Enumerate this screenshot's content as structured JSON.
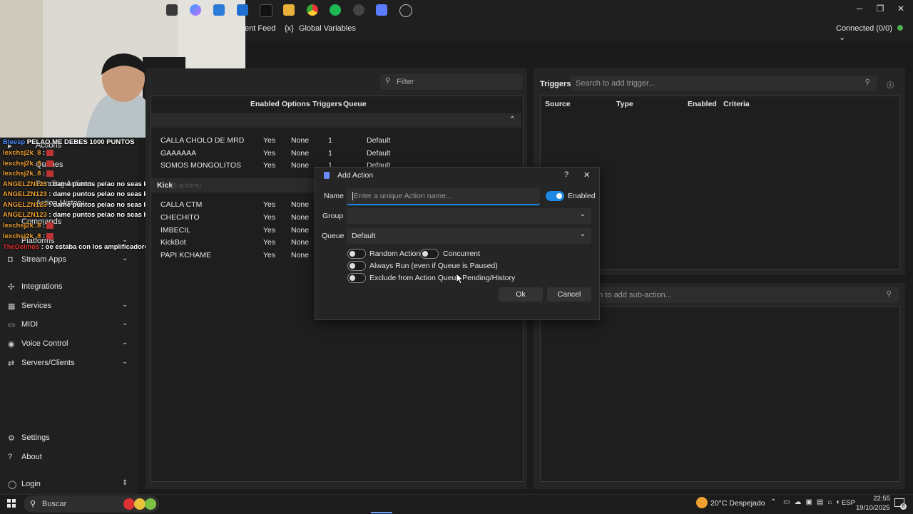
{
  "window": {
    "nav_event_feed": "ent Feed",
    "nav_global_variables": "Global Variables",
    "global_vars_icon": "{x}",
    "connection_status": "Connected (0/0)",
    "status_color": "#4caf50",
    "win_minimize": "─",
    "win_maximize": "❐",
    "win_close": "✕"
  },
  "sidebar": {
    "items": [
      {
        "label": "Actions",
        "icon": "actions-icon"
      },
      {
        "label": "Queues",
        "icon": "queues-icon"
      },
      {
        "label": "Pending Actions",
        "icon": "pending-icon"
      },
      {
        "label": "Action History",
        "icon": "history-icon"
      },
      {
        "label": "Commands",
        "icon": "commands-icon"
      },
      {
        "label": "Platforms",
        "icon": "platforms-icon"
      },
      {
        "label": "Stream Apps",
        "icon": "stream-apps-icon"
      },
      {
        "label": "Integrations",
        "icon": "integrations-icon"
      },
      {
        "label": "Services",
        "icon": "services-icon"
      },
      {
        "label": "MIDI",
        "icon": "midi-icon"
      },
      {
        "label": "Voice Control",
        "icon": "voice-icon"
      },
      {
        "label": "Servers/Clients",
        "icon": "servers-icon"
      }
    ],
    "settings": "Settings",
    "about": "About",
    "login": "Login"
  },
  "chat": [
    {
      "user": "Bleesp",
      "msg": "PELAO ME DEBES 1000 PUNTOS",
      "color": "blue"
    },
    {
      "user": "lexchsj2k_8",
      "msg": ":",
      "color": "orange"
    },
    {
      "user": "lexchsj2k_8",
      "msg": ":",
      "color": "orange"
    },
    {
      "user": "lexchsj2k_8",
      "msg": ":",
      "color": "orange"
    },
    {
      "user": "ANGELZN123",
      "msg": ": dame puntos pelao no seas kgon",
      "color": "orange"
    },
    {
      "user": "ANGELZN123",
      "msg": ": dame puntos pelao no seas kgon",
      "color": "orange"
    },
    {
      "user": "ANGELZN123",
      "msg": ": dame puntos pelao no seas kgon",
      "color": "orange"
    },
    {
      "user": "ANGELZN123",
      "msg": ": dame puntos pelao no seas kgon",
      "color": "orange"
    },
    {
      "user": "lexchsj2k_8",
      "msg": ":",
      "color": "orange"
    },
    {
      "user": "lexchsj2k_8",
      "msg": ":",
      "color": "orange"
    },
    {
      "user": "TheDeimos",
      "msg": ": oe estaba con los amplificadores",
      "color": "red"
    }
  ],
  "actions": {
    "filter_placeholder": "Filter",
    "columns": [
      "Enabled",
      "Options",
      "Triggers",
      "Queue"
    ],
    "rows_top": [
      {
        "name": "CALLA CHOLO DE MRD",
        "enabled": "Yes",
        "options": "None",
        "triggers": "1",
        "queue": "Default"
      },
      {
        "name": "GAAAAAA",
        "enabled": "Yes",
        "options": "None",
        "triggers": "1",
        "queue": "Default"
      },
      {
        "name": "SOMOS MONGOLITOS",
        "enabled": "Yes",
        "options": "None",
        "triggers": "1",
        "queue": "Default"
      }
    ],
    "group_kick": "Kick",
    "group_kick_count": "(5 actions)",
    "rows_kick": [
      {
        "name": "CALLA CTM",
        "enabled": "Yes",
        "options": "None"
      },
      {
        "name": "CHECHITO",
        "enabled": "Yes",
        "options": "None"
      },
      {
        "name": "IMBECIL",
        "enabled": "Yes",
        "options": "None"
      },
      {
        "name": "KickBot",
        "enabled": "Yes",
        "options": "None"
      },
      {
        "name": "PAPI KCHAME",
        "enabled": "Yes",
        "options": "None"
      }
    ]
  },
  "triggers": {
    "title": "Triggers",
    "search_placeholder": "Search to add trigger...",
    "columns": [
      "Source",
      "Type",
      "Enabled",
      "Criteria"
    ]
  },
  "subactions": {
    "search_placeholder": "rch to add sub-action..."
  },
  "dialog": {
    "title": "Add Action",
    "help": "?",
    "close": "✕",
    "name_label": "Name",
    "name_placeholder": "Enter a unique Action name...",
    "enabled_label": "Enabled",
    "group_label": "Group",
    "queue_label": "Queue",
    "queue_value": "Default",
    "random_action": "Random Action",
    "concurrent": "Concurrent",
    "always_run": "Always Run (even if Queue is Paused)",
    "exclude": "Exclude from Action Queue Pending/History",
    "ok": "Ok",
    "cancel": "Cancel"
  },
  "taskbar": {
    "search": "Buscar",
    "weather": "20°C Despejado",
    "lang": "ESP",
    "time": "22:55",
    "date": "19/10/2025",
    "notif_count": "8"
  }
}
